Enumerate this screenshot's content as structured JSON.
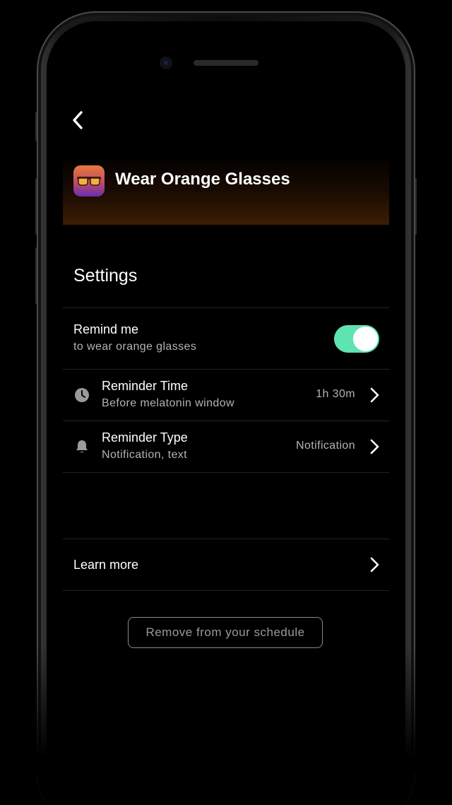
{
  "header": {
    "title": "Wear Orange Glasses",
    "back_icon": "chevron-left-icon",
    "app_icon": "orange-glasses-icon",
    "accent_color": "#e67a3c"
  },
  "settings": {
    "heading": "Settings",
    "remind": {
      "title": "Remind me",
      "subtitle": "to wear orange glasses",
      "enabled": true,
      "toggle_color": "#5fe3b0"
    },
    "reminder_time": {
      "icon": "clock-icon",
      "title": "Reminder Time",
      "subtitle": "Before melatonin window",
      "value": "1h 30m"
    },
    "reminder_type": {
      "icon": "bell-icon",
      "title": "Reminder Type",
      "subtitle": "Notification, text",
      "value": "Notification"
    }
  },
  "learn_more": {
    "label": "Learn more"
  },
  "remove_button": {
    "label": "Remove from your schedule"
  }
}
